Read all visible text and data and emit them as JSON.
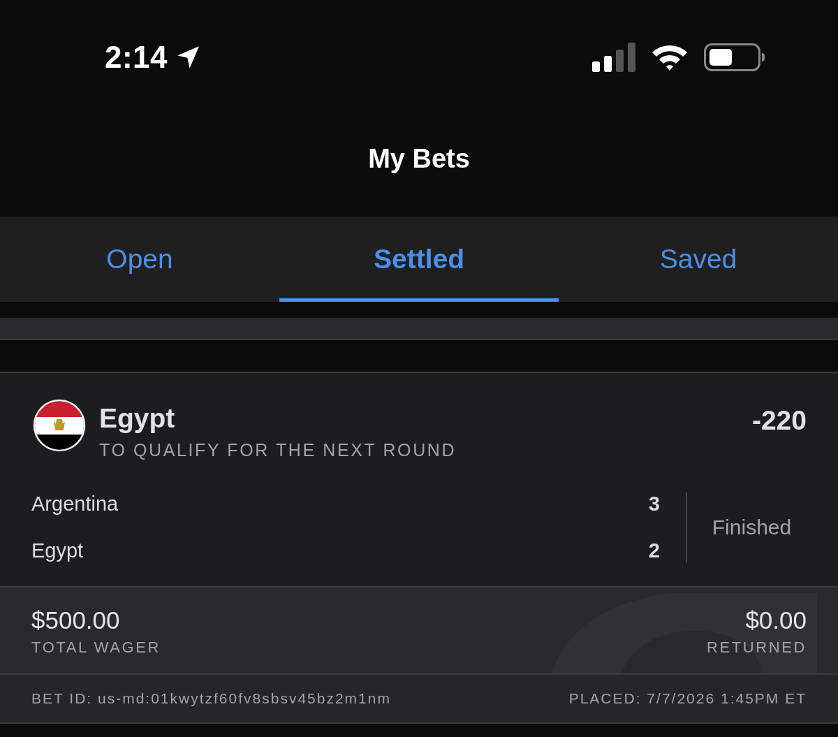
{
  "status_bar": {
    "time": "2:14"
  },
  "header": {
    "title": "My Bets"
  },
  "tabs": [
    {
      "label": "Open",
      "selected": false
    },
    {
      "label": "Settled",
      "selected": true
    },
    {
      "label": "Saved",
      "selected": false
    }
  ],
  "bets": [
    {
      "selection": "Egypt",
      "market": "TO QUALIFY FOR THE NEXT ROUND",
      "odds": "-220",
      "teams": [
        {
          "name": "Argentina",
          "score": "3"
        },
        {
          "name": "Egypt",
          "score": "2"
        }
      ],
      "status": "Finished",
      "wager": {
        "amount": "$500.00",
        "label": "TOTAL WAGER"
      },
      "returned": {
        "amount": "$0.00",
        "label": "RETURNED"
      },
      "bet_id": "BET ID: us-md:01kwytzf60fv8sbsv45bz2m1nm",
      "placed": "PLACED: 7/7/2026 1:45PM ET"
    }
  ]
}
